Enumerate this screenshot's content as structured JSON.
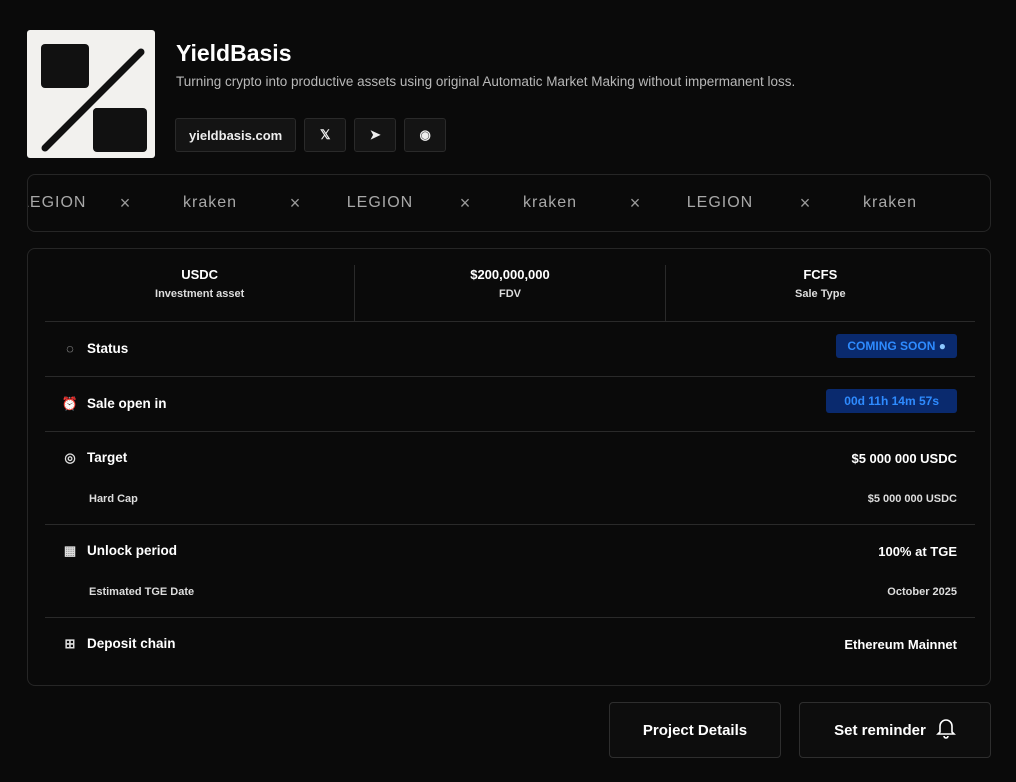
{
  "project": {
    "name": "YieldBasis",
    "description": "Turning crypto into productive assets using original Automatic Market Making without impermanent loss.",
    "website": "yieldbasis.com"
  },
  "social": [
    {
      "icon": "x-icon",
      "glyph": "𝕏"
    },
    {
      "icon": "telegram-icon",
      "glyph": "➤"
    },
    {
      "icon": "discord-icon",
      "glyph": "◉"
    }
  ],
  "partners": [
    "LEGION",
    "kraken",
    "LEGION",
    "kraken",
    "LEGION",
    "kraken"
  ],
  "stats": [
    {
      "value": "USDC",
      "label": "Investment asset"
    },
    {
      "value": "$200,000,000",
      "label": "FDV"
    },
    {
      "value": "FCFS",
      "label": "Sale Type"
    }
  ],
  "status": {
    "label": "Status",
    "value": "COMING SOON"
  },
  "sale_open": {
    "label": "Sale open in",
    "value": "00d 11h 14m 57s"
  },
  "target": {
    "label": "Target",
    "value": "$5 000 000 USDC",
    "sub_label": "Hard Cap",
    "sub_value": "$5 000 000 USDC"
  },
  "unlock": {
    "label": "Unlock period",
    "value": "100% at TGE",
    "sub_label": "Estimated TGE Date",
    "sub_value": "October 2025"
  },
  "chain": {
    "label": "Deposit chain",
    "value": "Ethereum Mainnet"
  },
  "buttons": {
    "details": "Project Details",
    "reminder": "Set reminder"
  },
  "colors": {
    "badge_bg": "#0a2a6e",
    "badge_text": "#2e8bff"
  }
}
